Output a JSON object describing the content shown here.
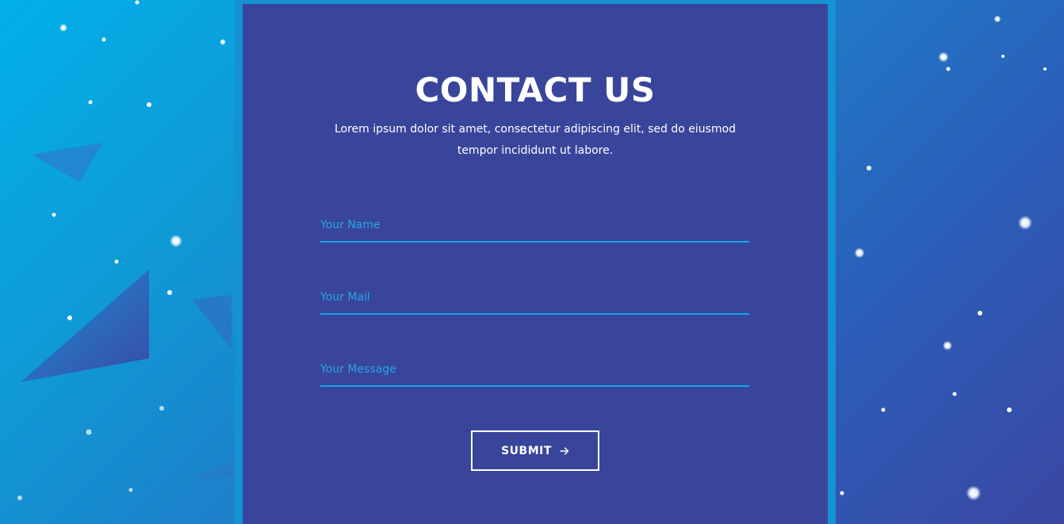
{
  "contact": {
    "title": "CONTACT US",
    "description": "Lorem ipsum dolor sit amet, consectetur adipiscing elit, sed do eiusmod tempor incididunt ut labore."
  },
  "form": {
    "name_placeholder": "Your Name",
    "mail_placeholder": "Your Mail",
    "message_placeholder": "Your Message",
    "submit_label": "SUBMIT",
    "submit_icon": "arrow-right-icon"
  },
  "colors": {
    "card_background": "#39459b",
    "card_border": "#1592d2",
    "accent": "#14a8e6",
    "placeholder": "#2aa5e6",
    "text": "#ffffff",
    "background_start": "#02b0ea",
    "background_end": "#3b47a2"
  }
}
